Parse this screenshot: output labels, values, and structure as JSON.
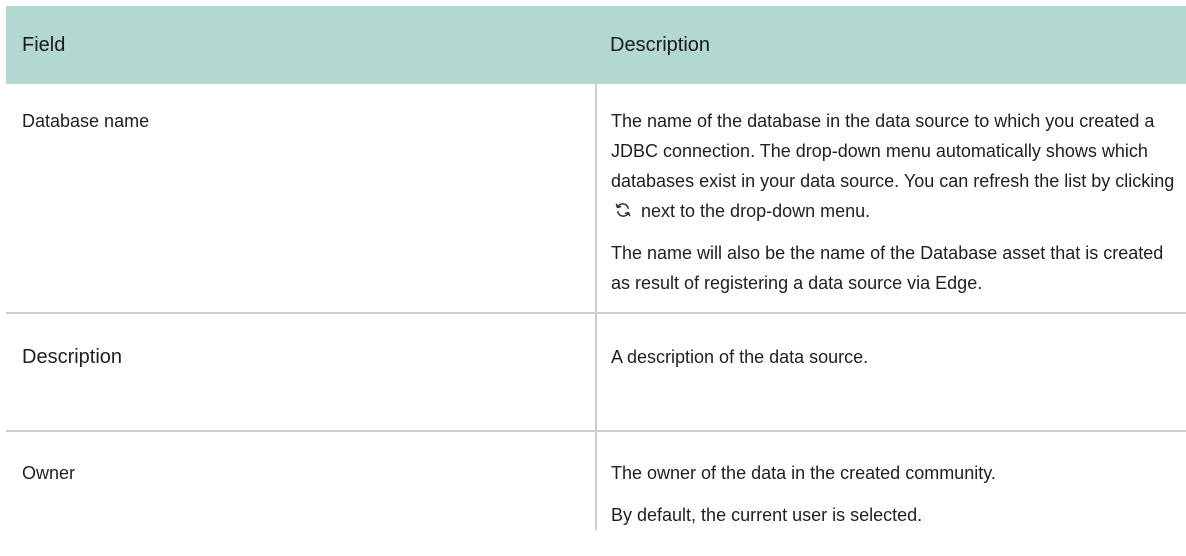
{
  "table": {
    "headers": {
      "field": "Field",
      "description": "Description"
    },
    "rows": [
      {
        "field": "Database name",
        "desc_p1_before_icon": "The name of the database in the data source to which you created a JDBC connection. The drop-down menu automatically shows which databases exist in your data source. You can refresh the list by clicking",
        "icon": "refresh-icon",
        "desc_p1_after_icon": "next to the drop-down menu.",
        "desc_p2": "The name will also be the name of the Database asset that is created as result of registering a data source via Edge."
      },
      {
        "field": "Description",
        "desc_p1": "A description of the data source."
      },
      {
        "field": "Owner",
        "desc_p1": "The owner of the data in the created community.",
        "desc_p2": "By default, the current user is selected."
      }
    ]
  },
  "colors": {
    "header_bg": "#b3d8d1",
    "border": "#cfcfcf",
    "text": "#1f1f1f"
  }
}
